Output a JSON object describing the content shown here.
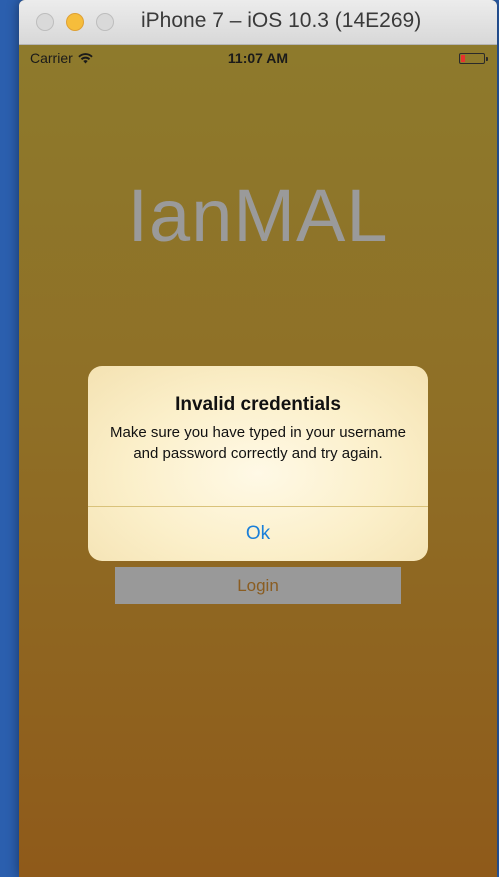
{
  "window": {
    "title": "iPhone 7 – iOS 10.3 (14E269)"
  },
  "statusbar": {
    "carrier": "Carrier",
    "time": "11:07 AM",
    "battery_color": "#e8322d"
  },
  "app": {
    "title": "IanMAL",
    "login_label": "Login"
  },
  "alert": {
    "title": "Invalid credentials",
    "message": "Make sure you have typed in your username and password correctly and try again.",
    "ok_label": "Ok",
    "ok_color": "#1a7fd9"
  },
  "icons": [
    "wifi-icon",
    "battery-icon"
  ]
}
